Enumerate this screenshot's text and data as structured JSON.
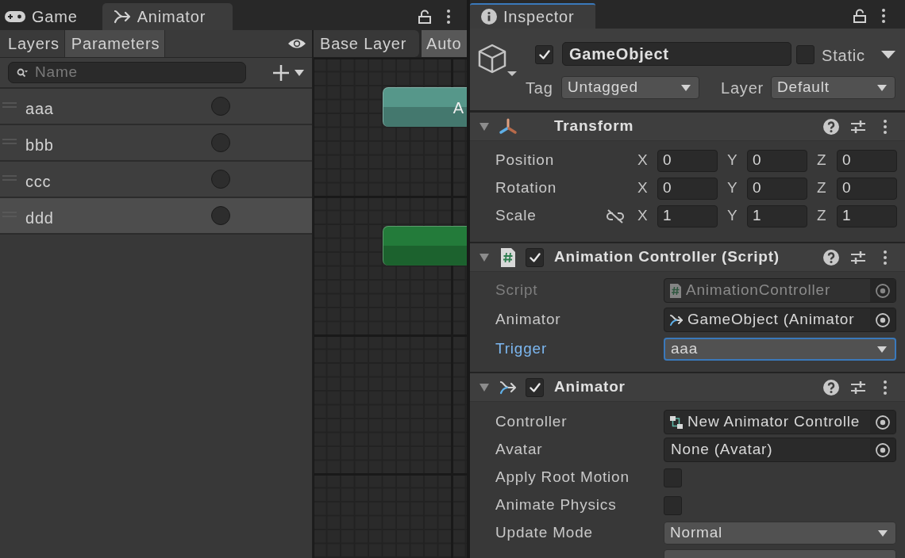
{
  "animator_window": {
    "tabs": [
      {
        "label": "Game",
        "selected": false
      },
      {
        "label": "Animator",
        "selected": true
      }
    ],
    "panel_tabs": [
      {
        "label": "Layers",
        "selected": false
      },
      {
        "label": "Parameters",
        "selected": true
      }
    ],
    "search": {
      "placeholder": "Name"
    },
    "parameters": [
      {
        "name": "aaa",
        "on": false,
        "selected": false
      },
      {
        "name": "bbb",
        "on": false,
        "selected": false
      },
      {
        "name": "ccc",
        "on": false,
        "selected": false
      },
      {
        "name": "ddd",
        "on": false,
        "selected": true
      }
    ],
    "breadcrumb": "Base Layer",
    "auto_button": "Auto",
    "nodes": [
      {
        "label": "A",
        "color": "#56978a"
      },
      {
        "color": "#237b3a"
      }
    ]
  },
  "inspector": {
    "tab": "Inspector",
    "object": {
      "active": true,
      "name": "GameObject",
      "static": false,
      "static_label": "Static",
      "tag_label": "Tag",
      "tag": "Untagged",
      "layer_label": "Layer",
      "layer": "Default"
    },
    "components": [
      {
        "kind": "transform",
        "title": "Transform",
        "expanded": true,
        "rows": [
          {
            "label": "Position",
            "values": [
              {
                "axis": "X",
                "value": "0"
              },
              {
                "axis": "Y",
                "value": "0"
              },
              {
                "axis": "Z",
                "value": "0"
              }
            ]
          },
          {
            "label": "Rotation",
            "values": [
              {
                "axis": "X",
                "value": "0"
              },
              {
                "axis": "Y",
                "value": "0"
              },
              {
                "axis": "Z",
                "value": "0"
              }
            ]
          },
          {
            "label": "Scale",
            "linked": false,
            "values": [
              {
                "axis": "X",
                "value": "1"
              },
              {
                "axis": "Y",
                "value": "1"
              },
              {
                "axis": "Z",
                "value": "1"
              }
            ]
          }
        ]
      },
      {
        "kind": "script",
        "title": "Animation Controller (Script)",
        "enabled": true,
        "expanded": true,
        "rows": [
          {
            "kind": "object",
            "label": "Script",
            "value": "AnimationController",
            "disabled": true,
            "focused": false
          },
          {
            "kind": "object",
            "label": "Animator",
            "value": "GameObject (Animator",
            "disabled": false,
            "focused": false
          },
          {
            "kind": "dropdown",
            "label": "Trigger",
            "value": "aaa",
            "disabled": false,
            "focused": true
          }
        ]
      },
      {
        "kind": "animator",
        "title": "Animator",
        "enabled": true,
        "expanded": true,
        "rows": [
          {
            "kind": "object",
            "label": "Controller",
            "value": "New Animator Controlle",
            "disabled": false,
            "focused": false
          },
          {
            "kind": "object",
            "label": "Avatar",
            "value": "None (Avatar)",
            "disabled": false,
            "focused": false
          },
          {
            "kind": "checkbox",
            "label": "Apply Root Motion",
            "checked": false,
            "disabled": false,
            "focused": false
          },
          {
            "kind": "checkbox",
            "label": "Animate Physics",
            "checked": false,
            "disabled": false,
            "focused": false
          },
          {
            "kind": "dropdown",
            "label": "Update Mode",
            "value": "Normal",
            "disabled": false,
            "focused": false
          },
          {
            "kind": "dropdown",
            "disabled": false,
            "focused": false
          }
        ]
      }
    ]
  }
}
